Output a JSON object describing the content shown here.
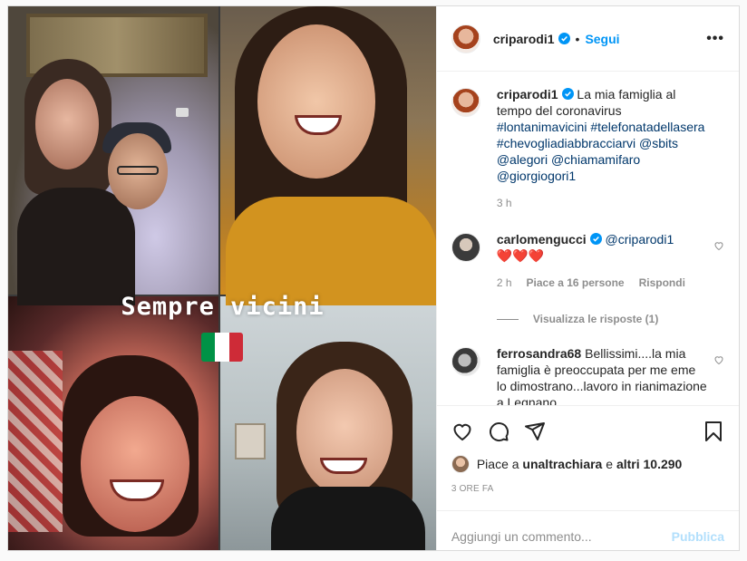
{
  "colors": {
    "accent": "#0095f6",
    "link": "#00376b",
    "muted": "#8e8e8e",
    "heart": "#ed4956",
    "publish_disabled": "#b2dffc"
  },
  "media": {
    "sticker_text": "Sempre vicini",
    "flag": "italian-flag",
    "flag_colors": [
      "#009246",
      "#ffffff",
      "#ce2b37"
    ]
  },
  "header": {
    "username": "criparodi1",
    "separator": "•",
    "follow_label": "Segui",
    "more_icon": "more-horizontal-icon",
    "more_label": "•••"
  },
  "caption": {
    "username": "criparodi1",
    "text": "La mia famiglia al tempo del coronavirus",
    "hashtags": [
      "#lontanimavicini",
      "#telefonatadellasera",
      "#chevogliadiabbracciarvi"
    ],
    "mentions": [
      "@sbits",
      "@alegori",
      "@chiamamifaro",
      "@giorgiogori1"
    ],
    "time": "3 h"
  },
  "comments": [
    {
      "username": "carlomengucci",
      "mention": "@criparodi1",
      "text": "❤️❤️❤️",
      "time": "2 h",
      "likes_label": "Piace a 16 persone",
      "reply_label": "Rispondi",
      "view_replies": "Visualizza le risposte (1)"
    },
    {
      "username": "ferrosandra68",
      "text": "Bellissimi....la mia famiglia è preoccupata per me eme lo dimostrano...lavoro in rianimazione a Legnano"
    }
  ],
  "actions": {
    "icons": [
      "heart-icon",
      "comment-icon",
      "share-icon",
      "bookmark-icon"
    ]
  },
  "likes": {
    "prefix": "Piace a",
    "user": "unaltrachiara",
    "conjunction": "e",
    "others": "altri 10.290"
  },
  "timestamp": "3 ORE FA",
  "add_comment": {
    "placeholder": "Aggiungi un commento...",
    "publish_label": "Pubblica"
  }
}
